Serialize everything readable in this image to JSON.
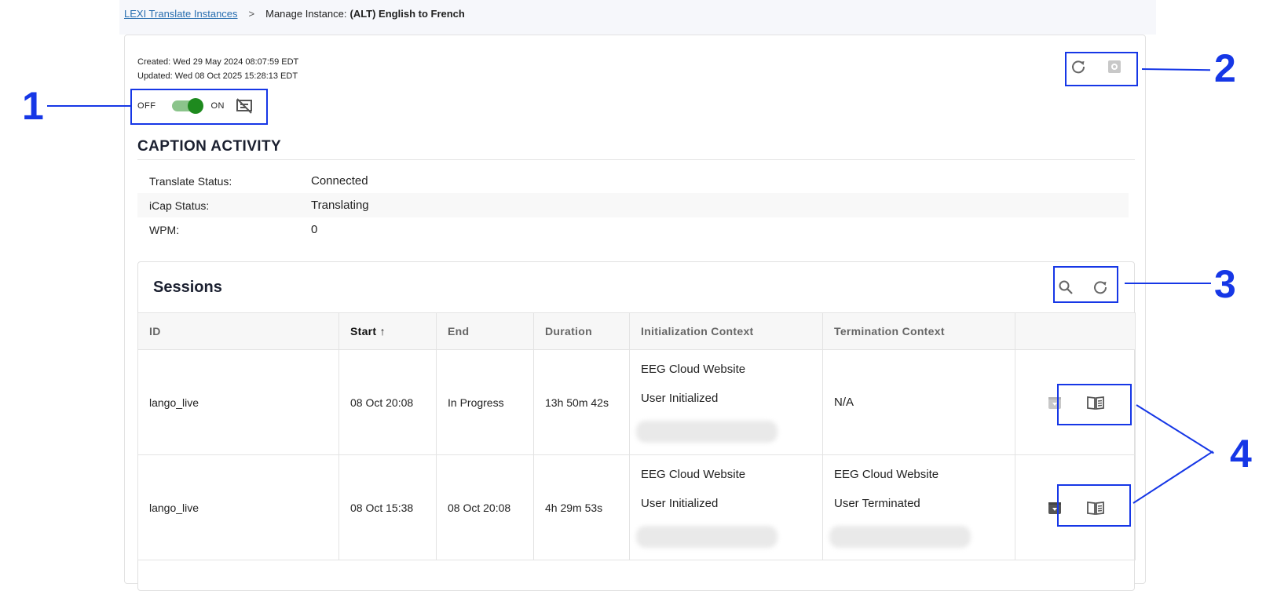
{
  "breadcrumb": {
    "link": "LEXI Translate Instances",
    "separator": ">",
    "prefix": "Manage Instance:",
    "current": "(ALT) English to French"
  },
  "instance": {
    "created": "Created: Wed 29 May 2024 08:07:59 EDT",
    "updated": "Updated: Wed 08 Oct 2025 15:28:13 EDT",
    "toggle": {
      "off_label": "OFF",
      "on_label": "ON",
      "state": "on"
    }
  },
  "caption_activity": {
    "title": "CAPTION ACTIVITY",
    "rows": [
      {
        "label": "Translate Status:",
        "value": "Connected"
      },
      {
        "label": "iCap Status:",
        "value": "Translating"
      },
      {
        "label": "WPM:",
        "value": "0"
      }
    ]
  },
  "sessions": {
    "title": "Sessions",
    "columns": [
      "ID",
      "Start",
      "End",
      "Duration",
      "Initialization Context",
      "Termination Context",
      ""
    ],
    "sort_indicator": "↑",
    "rows": [
      {
        "id": "lango_live",
        "start": "08 Oct 20:08",
        "end": "In Progress",
        "duration": "13h 50m 42s",
        "init": [
          "EEG Cloud Website",
          "User Initialized"
        ],
        "term": "N/A"
      },
      {
        "id": "lango_live",
        "start": "08 Oct 15:38",
        "end": "08 Oct 20:08",
        "duration": "4h 29m 53s",
        "init": [
          "EEG Cloud Website",
          "User Initialized"
        ],
        "term": [
          "EEG Cloud Website",
          "User Terminated"
        ]
      }
    ]
  },
  "annotations": [
    "1",
    "2",
    "3",
    "4"
  ],
  "colors": {
    "annotation": "#1637e6",
    "toggle_on": "#1e8a1e",
    "link": "#2a6fb0"
  }
}
